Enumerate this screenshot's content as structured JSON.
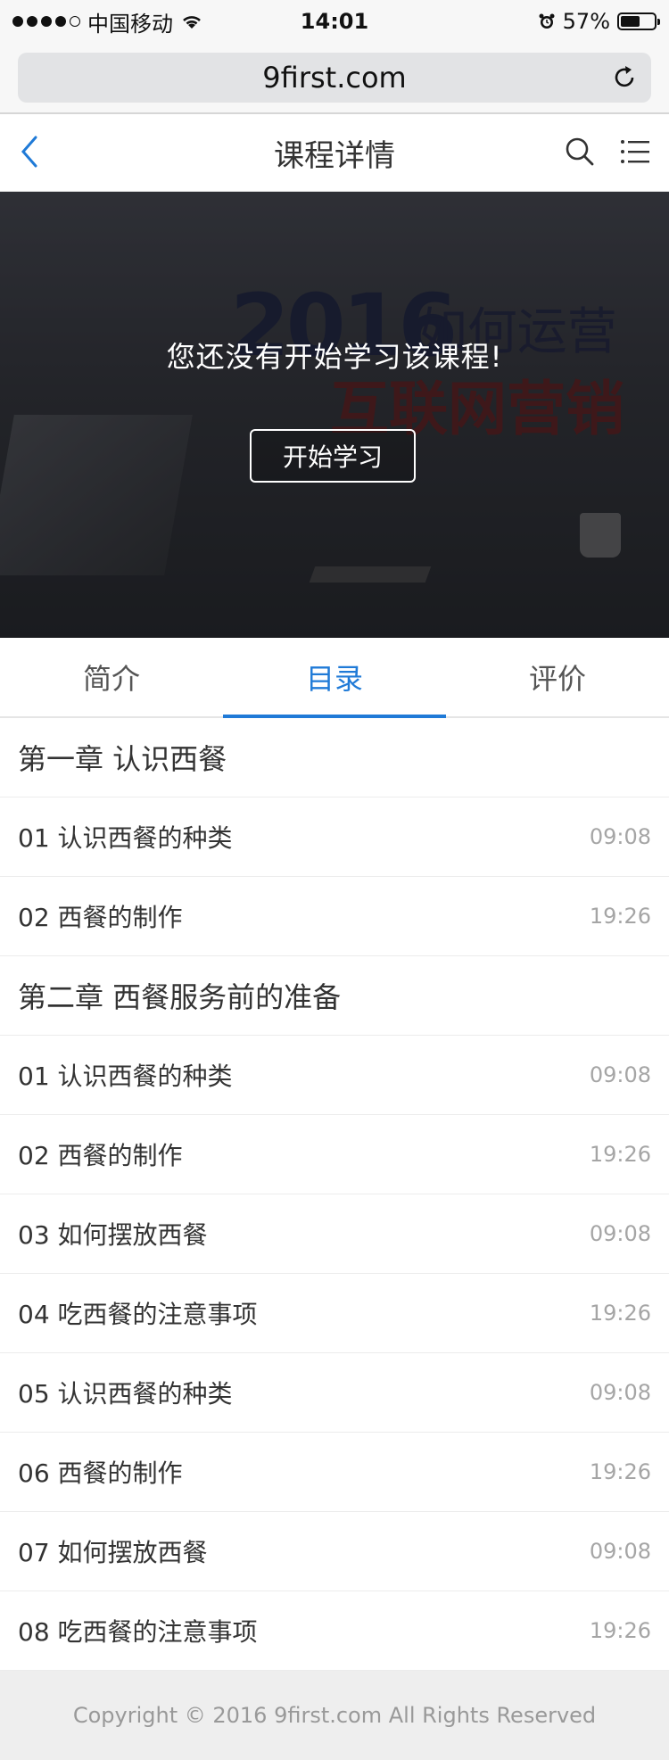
{
  "status_bar": {
    "carrier": "中国移动",
    "time": "14:01",
    "battery_percent_text": "57%",
    "battery_level": 0.57
  },
  "browser": {
    "url": "9first.com",
    "reload_icon": "reload-icon"
  },
  "nav": {
    "title": "课程详情",
    "back_icon": "back-chevron-icon",
    "search_icon": "search-icon",
    "menu_icon": "list-menu-icon"
  },
  "hero": {
    "bg_year": "2016",
    "bg_subtitle": ",如何运营",
    "bg_red": "互联网营销",
    "message": "您还没有开始学习该课程!",
    "start_button": "开始学习"
  },
  "tabs": [
    {
      "label": "简介",
      "active": false
    },
    {
      "label": "目录",
      "active": true
    },
    {
      "label": "评价",
      "active": false
    }
  ],
  "chapters": [
    {
      "title": "第一章  认识西餐",
      "lessons": [
        {
          "title": "01 认识西餐的种类",
          "time": "09:08"
        },
        {
          "title": "02 西餐的制作",
          "time": "19:26"
        }
      ]
    },
    {
      "title": "第二章  西餐服务前的准备",
      "lessons": [
        {
          "title": "01 认识西餐的种类",
          "time": "09:08"
        },
        {
          "title": "02 西餐的制作",
          "time": "19:26"
        },
        {
          "title": "03 如何摆放西餐",
          "time": "09:08"
        },
        {
          "title": "04 吃西餐的注意事项",
          "time": "19:26"
        },
        {
          "title": "05 认识西餐的种类",
          "time": "09:08"
        },
        {
          "title": "06 西餐的制作",
          "time": "19:26"
        },
        {
          "title": "07 如何摆放西餐",
          "time": "09:08"
        },
        {
          "title": "08 吃西餐的注意事项",
          "time": "19:26"
        }
      ]
    }
  ],
  "footer": {
    "copyright": "Copyright © 2016 9first.com All Rights Reserved"
  },
  "colors": {
    "accent": "#1f7ad7",
    "muted_text": "#a5a5a5"
  }
}
